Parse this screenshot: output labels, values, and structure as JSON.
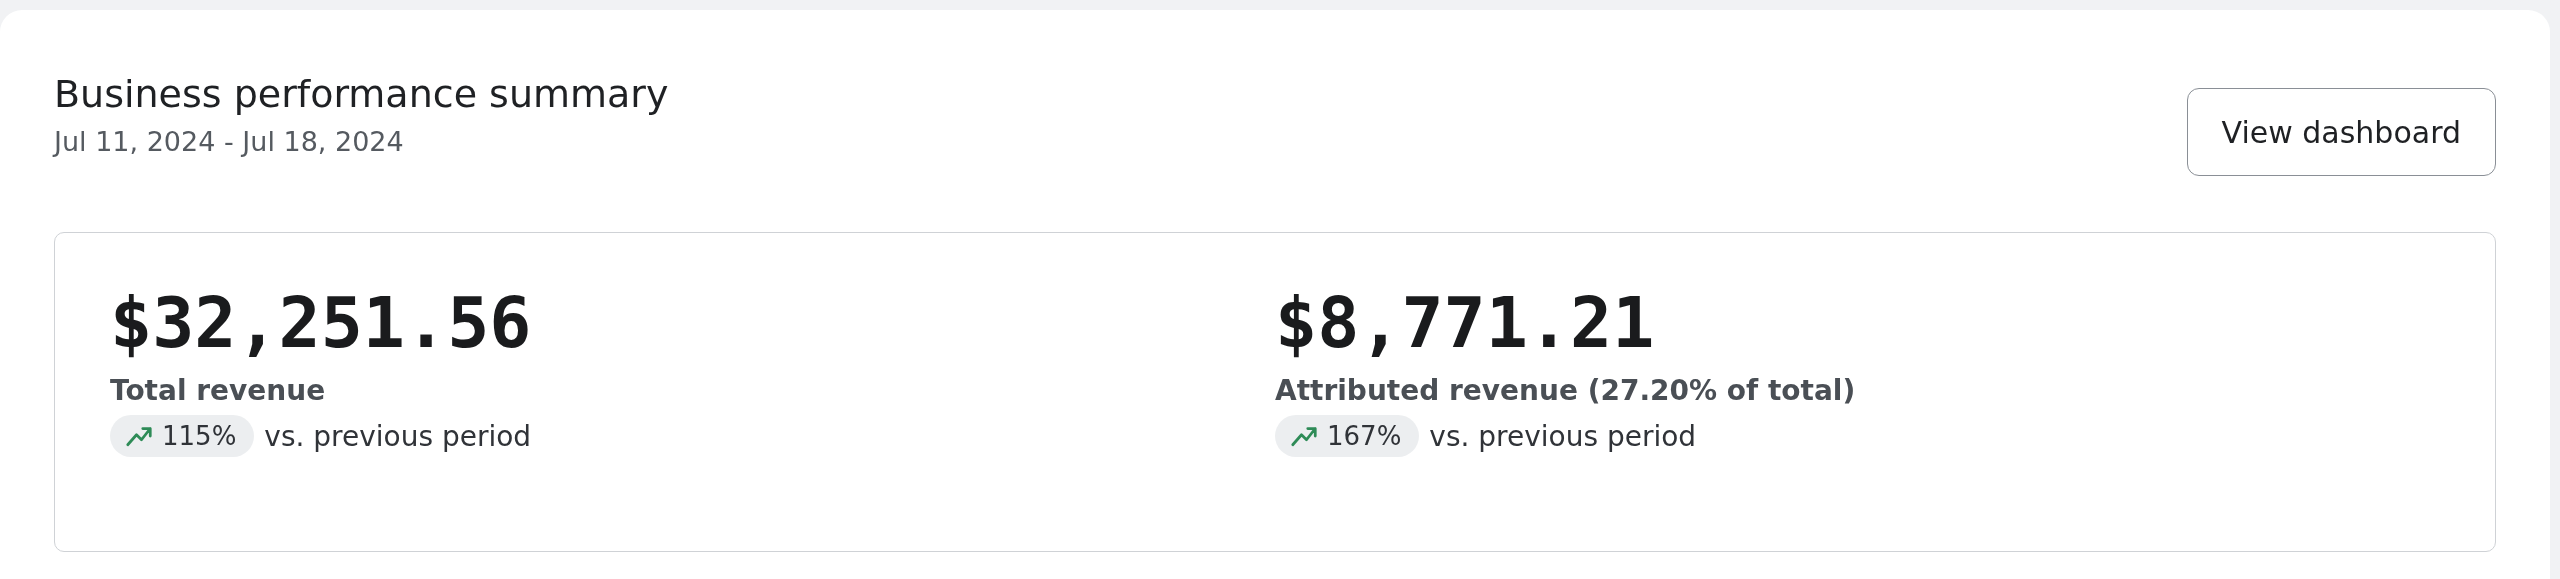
{
  "header": {
    "title": "Business performance summary",
    "date_range": "Jul 11, 2024 - Jul 18, 2024",
    "button": "View dashboard"
  },
  "metrics": [
    {
      "value": "$32,251.56",
      "label": "Total revenue",
      "change": "115%",
      "comparison": "vs. previous period"
    },
    {
      "value": "$8,771.21",
      "label": "Attributed revenue (27.20% of total)",
      "change": "167%",
      "comparison": "vs. previous period"
    }
  ]
}
